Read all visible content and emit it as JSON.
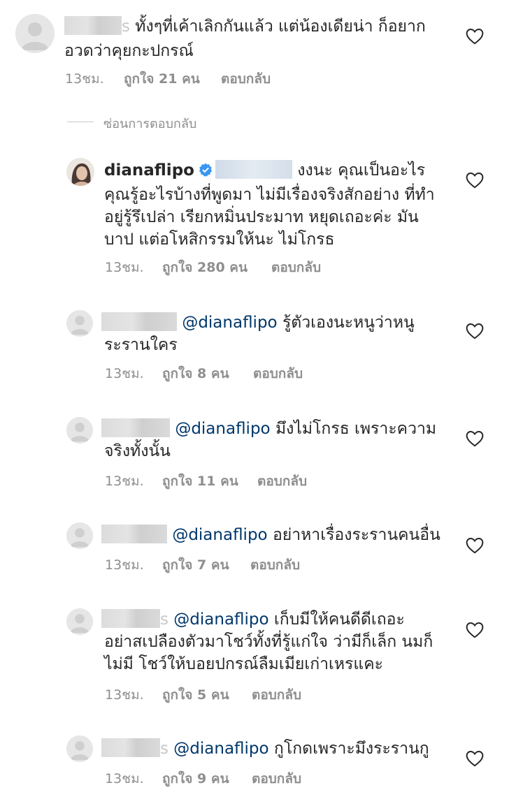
{
  "hide_replies_label": "ซ่อนการตอบกลับ",
  "comments": [
    {
      "username_suffix": "s",
      "text_line1": "ทั้งๆที่เค้าเลิกกันแล้ว แต่น้องเดียน่า ก็อยาก",
      "text_line2": "อวดว่าคุยกะปกรณ์",
      "time": "13ชม.",
      "likes": "ถูกใจ 21 คน",
      "reply": "ตอบกลับ"
    },
    {
      "username": "dianaflipo",
      "verified": true,
      "text_line1_tail": "งงนะ คุณเป็นอะไร",
      "text_line2": "คุณรู้อะไรบ้างที่พูดมา ไม่มีเรื่องจริงสักอย่าง ที่ทำ",
      "text_line3": "อยู่รู้รึเปล่า เรียกหมิ่นประมาท หยุดเถอะค่ะ มัน",
      "text_line4": "บาป แต่อโหสิกรรมให้นะ ไม่โกรธ",
      "time": "13ชม.",
      "likes": "ถูกใจ 280 คน",
      "reply": "ตอบกลับ"
    },
    {
      "mention": "@dianaflipo",
      "text_line1": "รู้ตัวเองนะหนูว่าหนู",
      "text_line2": "ระรานใคร",
      "time": "13ชม.",
      "likes": "ถูกใจ 8 คน",
      "reply": "ตอบกลับ"
    },
    {
      "mention": "@dianaflipo",
      "text_line1": "มึงไม่โกรธ เพราะความ",
      "text_line2": "จริงทั้งนั้น",
      "time": "13ชม.",
      "likes": "ถูกใจ 11 คน",
      "reply": "ตอบกลับ"
    },
    {
      "mention": "@dianaflipo",
      "text_line1": "อย่าหาเรื่องระรานคนอื่น",
      "time": "13ชม.",
      "likes": "ถูกใจ 7 คน",
      "reply": "ตอบกลับ"
    },
    {
      "username_suffix": "s",
      "mention": "@dianaflipo",
      "text_line1": "เก็บมีให้คนดีดีเถอะ",
      "text_line2": "อย่าสเปลืองตัวมาโชว์ทั้งที่รู้แก่ใจ ว่ามีก็เล็ก นมก็",
      "text_line3": "ไม่มี โชว์ให้บอยปกรณ์ลืมเมียเก่าเหรแคะ",
      "time": "13ชม.",
      "likes": "ถูกใจ 5 คน",
      "reply": "ตอบกลับ"
    },
    {
      "username_suffix": "s",
      "mention": "@dianaflipo",
      "text_line1": "กูโกดเพราะมึงระรานกู",
      "time": "13ชม.",
      "likes": "ถูกใจ 9 คน",
      "reply": "ตอบกลับ"
    }
  ],
  "icons": {
    "avatar": "default-avatar-icon",
    "like": "heart-outline-icon",
    "verified": "verified-badge-icon"
  },
  "colors": {
    "text": "#262626",
    "meta": "#8e8e8e",
    "mention": "#00376b",
    "verified": "#3897f0"
  }
}
